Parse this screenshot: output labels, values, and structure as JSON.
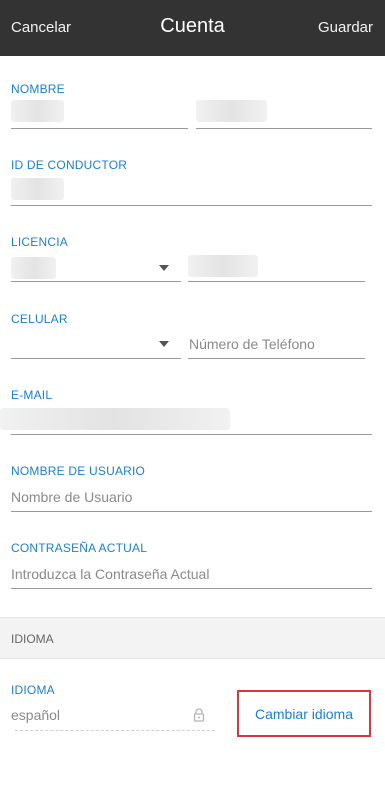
{
  "header": {
    "cancel_label": "Cancelar",
    "title": "Cuenta",
    "save_label": "Guardar"
  },
  "fields": {
    "nombre": {
      "label": "NOMBRE"
    },
    "id_conductor": {
      "label": "ID DE CONDUCTOR"
    },
    "licencia": {
      "label": "LICENCIA"
    },
    "celular": {
      "label": "CELULAR",
      "phone_placeholder": "Número de Teléfono"
    },
    "email": {
      "label": "E-MAIL"
    },
    "usuario": {
      "label": "NOMBRE DE USUARIO",
      "placeholder": "Nombre de Usuario"
    },
    "contrasena": {
      "label": "CONTRASEÑA ACTUAL",
      "placeholder": "Introduzca la Contraseña Actual"
    }
  },
  "section": {
    "title": "IDIOMA"
  },
  "idioma": {
    "label": "IDIOMA",
    "value": "español",
    "change_label": "Cambiar idioma"
  },
  "colors": {
    "header_bg": "#333333",
    "accent": "#1a7fd6",
    "highlight_border": "#d9363e"
  },
  "icons": {
    "lock": "lock-icon",
    "dropdown": "chevron-down-icon"
  }
}
